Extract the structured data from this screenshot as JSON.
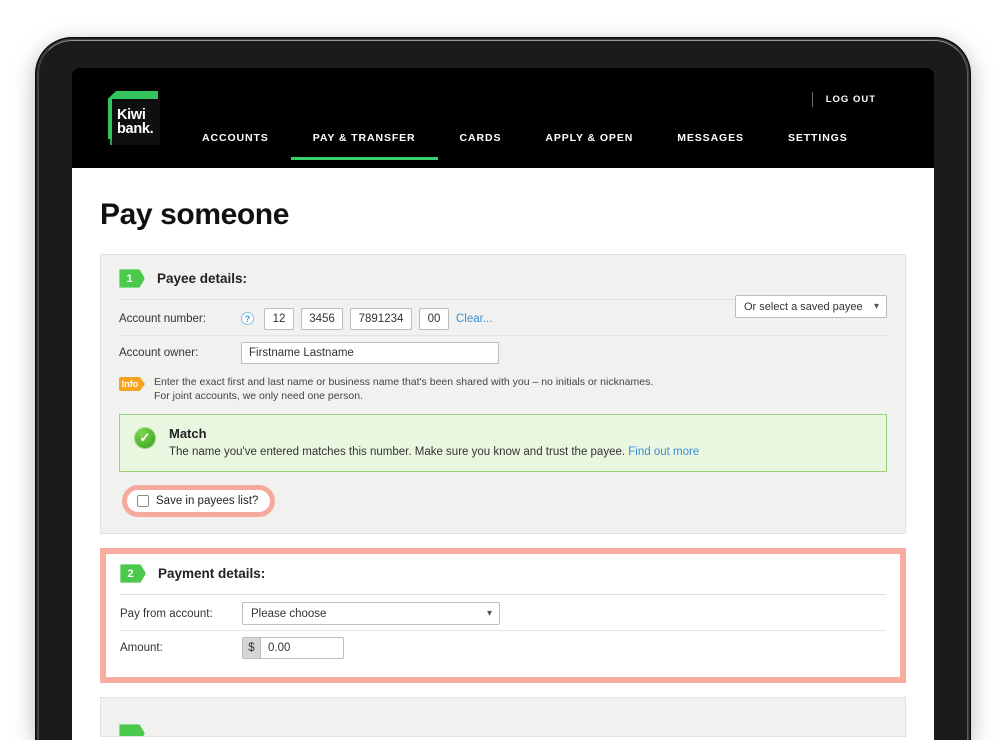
{
  "header": {
    "logo": {
      "line1": "Kiwi",
      "line2": "bank."
    },
    "logout_label": "LOG OUT",
    "nav": [
      {
        "label": "ACCOUNTS",
        "active": false
      },
      {
        "label": "PAY & TRANSFER",
        "active": true
      },
      {
        "label": "CARDS",
        "active": false
      },
      {
        "label": "APPLY & OPEN",
        "active": false
      },
      {
        "label": "MESSAGES",
        "active": false
      },
      {
        "label": "SETTINGS",
        "active": false
      }
    ]
  },
  "page": {
    "title": "Pay someone"
  },
  "section1": {
    "step": "1",
    "title": "Payee details:",
    "account_number": {
      "label": "Account number:",
      "help_icon": "question-mark-icon",
      "bank": "12",
      "branch": "3456",
      "account": "7891234",
      "suffix": "00",
      "clear_label": "Clear..."
    },
    "saved_payee": {
      "label": "Or select a saved payee",
      "chevron": "chevron-down-icon"
    },
    "account_owner": {
      "label": "Account owner:",
      "value": "Firstname Lastname",
      "placeholder": "Firstname Lastname"
    },
    "info": {
      "badge": "Info",
      "line1": "Enter the exact first and last name or business name that's been shared with you – no initials or nicknames.",
      "line2": "For joint accounts, we only need one person."
    },
    "match": {
      "icon": "check-circle-icon",
      "title": "Match",
      "text": "The name you've entered matches this number. Make sure you know and trust the payee.",
      "link_label": "Find out more"
    },
    "save_payee": {
      "label": "Save in payees list?",
      "checked": false
    }
  },
  "section2": {
    "step": "2",
    "title": "Payment details:",
    "pay_from": {
      "label": "Pay from account:",
      "value": "Please choose",
      "chevron": "chevron-down-icon"
    },
    "amount": {
      "label": "Amount:",
      "prefix": "$",
      "value": "0.00",
      "placeholder": "0.00"
    }
  },
  "colors": {
    "brand_green": "#32c35f",
    "nav_active": "#35d06a",
    "step_badge": "#4bc94b",
    "highlight_pink": "#f6ada0",
    "match_bg": "#e9f6e0",
    "match_border": "#9ccf7a",
    "link_blue": "#3a8fd0",
    "info_orange": "#f6a21e"
  }
}
